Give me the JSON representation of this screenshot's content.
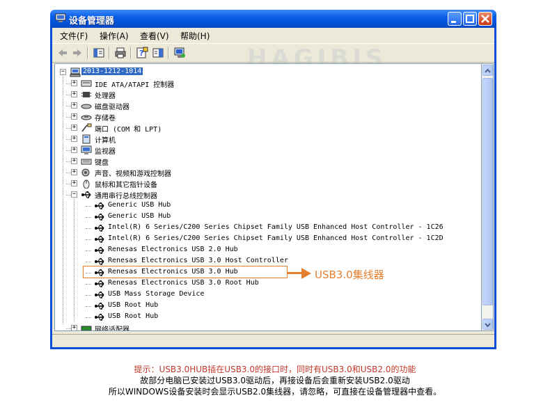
{
  "window": {
    "title": "设备管理器",
    "watermark": "HAGIBIS"
  },
  "menu": [
    "文件(F)",
    "操作(A)",
    "查看(V)",
    "帮助(H)"
  ],
  "toolbar_icons": [
    "back-arrow-icon",
    "forward-arrow-icon",
    "properties-icon",
    "print-icon",
    "help-icon",
    "view-icon",
    "scan-hardware-icon"
  ],
  "tree": {
    "root": "2013-1212-1014",
    "categories": [
      {
        "label": "IDE ATA/ATAPI 控制器",
        "icon": "ide-controller-icon"
      },
      {
        "label": "处理器",
        "icon": "processor-icon"
      },
      {
        "label": "磁盘驱动器",
        "icon": "disk-drive-icon"
      },
      {
        "label": "存储卷",
        "icon": "storage-volume-icon"
      },
      {
        "label": "端口 (COM 和 LPT)",
        "icon": "port-icon"
      },
      {
        "label": "计算机",
        "icon": "computer-icon"
      },
      {
        "label": "监视器",
        "icon": "monitor-icon"
      },
      {
        "label": "键盘",
        "icon": "keyboard-icon"
      },
      {
        "label": "声音、视频和游戏控制器",
        "icon": "sound-icon"
      },
      {
        "label": "鼠标和其它指针设备",
        "icon": "mouse-icon"
      }
    ],
    "usb_category": "通用串行总线控制器",
    "usb_devices": [
      "Generic USB Hub",
      "Generic USB Hub",
      "Intel(R) 6 Series/C200 Series Chipset Family USB Enhanced Host Controller - 1C26",
      "Intel(R) 6 Series/C200 Series Chipset Family USB Enhanced Host Controller - 1C2D",
      "Renesas Electronics USB 2.0 Hub",
      "Renesas Electronics USB 3.0 Host Controller",
      "Renesas Electronics USB 3.0 Hub",
      "Renesas Electronics USB 3.0 Root Hub",
      "USB Mass Storage Device",
      "USB Root Hub",
      "USB Root Hub"
    ],
    "last_category": "网络适配器"
  },
  "annotation": {
    "callout": "USB3.0集线器",
    "color": "#e57e2d"
  },
  "notes": {
    "line1": "提示：USB3.0HUB插在USB3.0的接口时，同时有USB3.0和USB2.0的功能",
    "line2": "故部分电脑已安装过USB3.0驱动后，再接设备后会重新安装USB2.0驱动",
    "line3": "所以WINDOWS设备安装时会显示USB2.0集线器，请忽略，可直接在设备管理器中查看。",
    "line1_color": "#c0392b"
  }
}
